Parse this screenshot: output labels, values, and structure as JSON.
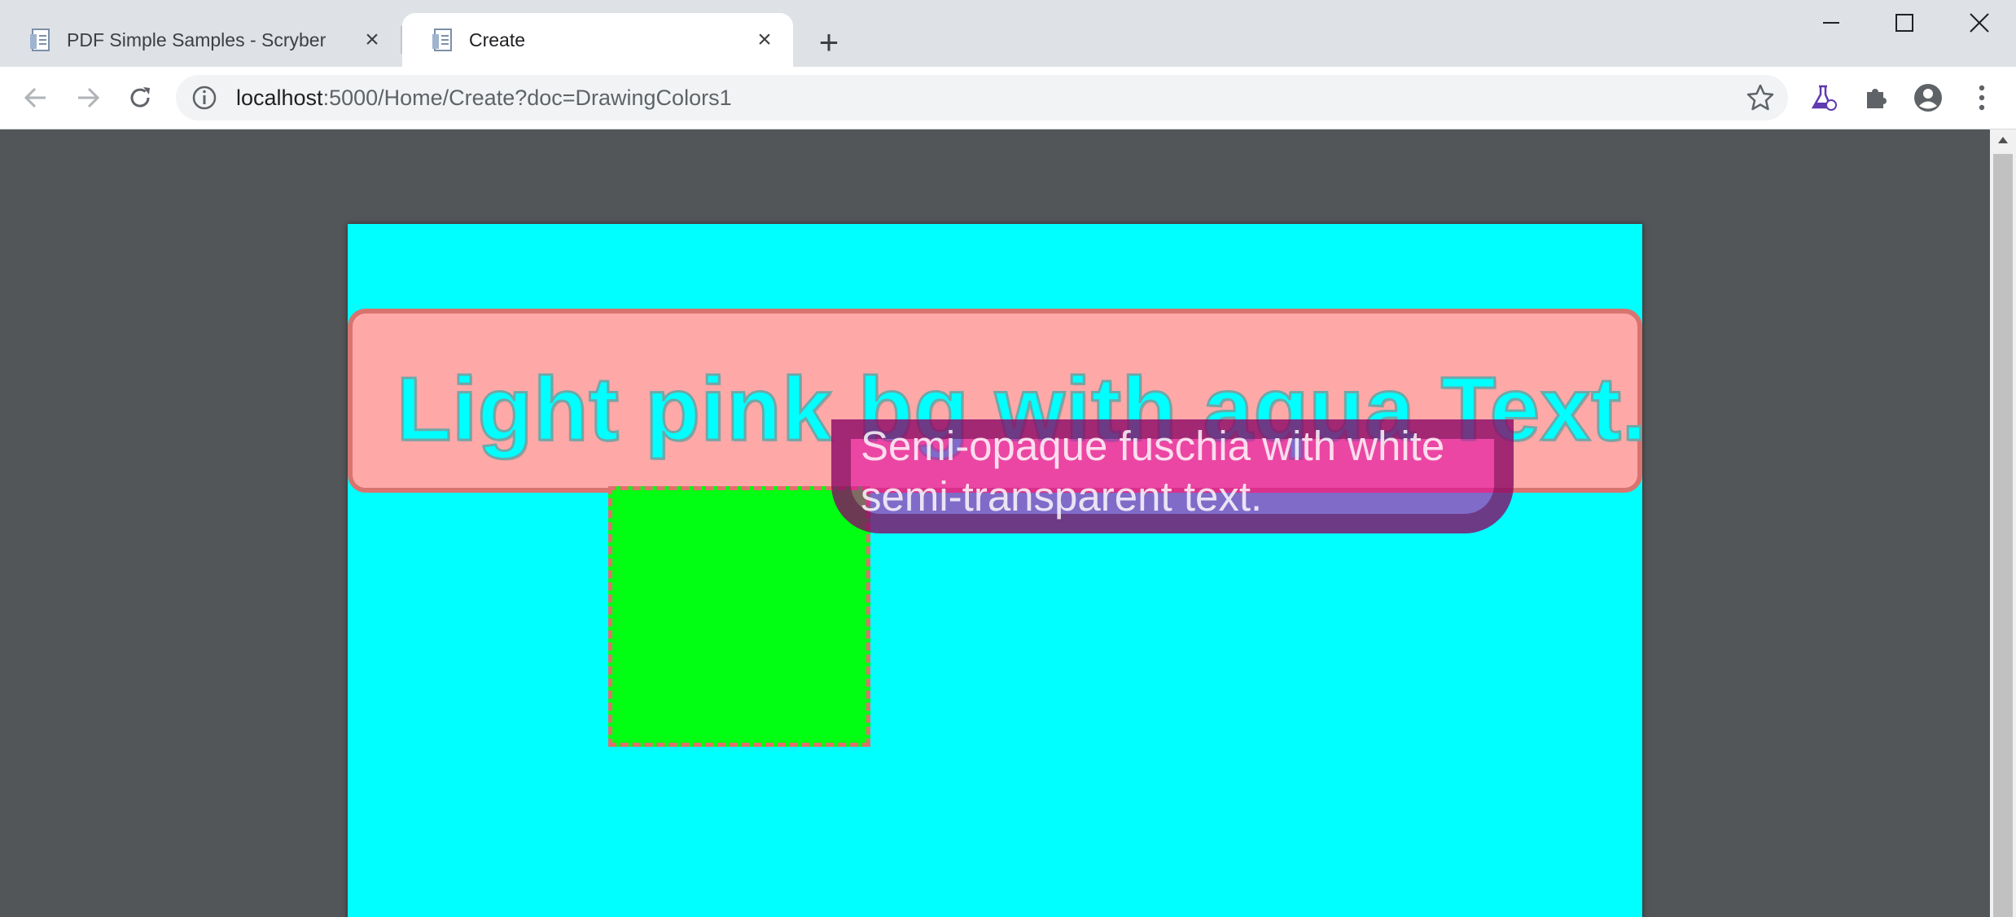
{
  "tabs": [
    {
      "title": "PDF Simple Samples - Scryber",
      "icon": "document-icon",
      "active": false
    },
    {
      "title": "Create",
      "icon": "document-icon",
      "active": true
    }
  ],
  "address_bar": {
    "host": "localhost",
    "path": ":5000/Home/Create?doc=DrawingColors1"
  },
  "pdf": {
    "background_color": "#00ffff",
    "heading": "Light pink bg with aqua Text.",
    "heading_bg": "#ffa8a8",
    "heading_color": "#00ffff",
    "square_color": "#00ff12",
    "overlay_text": "Semi-opaque fuschia with white semi-transparent text.",
    "overlay_color": "#dc00a0"
  }
}
